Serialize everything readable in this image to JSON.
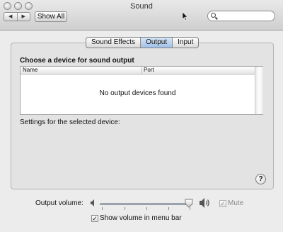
{
  "window": {
    "title": "Sound"
  },
  "toolbar": {
    "back_label": "◀",
    "forward_label": "▶",
    "show_all_label": "Show All",
    "search_value": ""
  },
  "tabs": [
    {
      "label": "Sound Effects",
      "active": false
    },
    {
      "label": "Output",
      "active": true
    },
    {
      "label": "Input",
      "active": false
    }
  ],
  "output": {
    "heading": "Choose a device for sound output",
    "columns": [
      "Name",
      "Port"
    ],
    "empty_message": "No output devices found",
    "settings_label": "Settings for the selected device:"
  },
  "help": {
    "label": "?"
  },
  "volume": {
    "label": "Output volume:",
    "level": 0.9,
    "mute_label": "Mute",
    "mute_checked": true,
    "mute_enabled": false,
    "menu_bar_label": "Show volume in menu bar",
    "menu_bar_checked": true
  },
  "colors": {
    "selected_tab": "#9fc0e8",
    "window_bg": "#ececec"
  }
}
